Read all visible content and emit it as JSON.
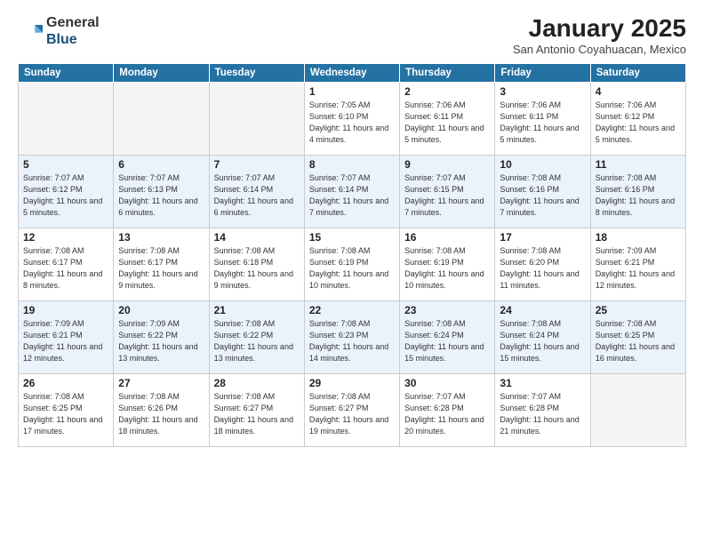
{
  "header": {
    "logo_general": "General",
    "logo_blue": "Blue",
    "month_year": "January 2025",
    "location": "San Antonio Coyahuacan, Mexico"
  },
  "days_of_week": [
    "Sunday",
    "Monday",
    "Tuesday",
    "Wednesday",
    "Thursday",
    "Friday",
    "Saturday"
  ],
  "weeks": [
    [
      {
        "num": "",
        "empty": true
      },
      {
        "num": "",
        "empty": true
      },
      {
        "num": "",
        "empty": true
      },
      {
        "num": "1",
        "sunrise": "7:05 AM",
        "sunset": "6:10 PM",
        "daylight": "11 hours and 4 minutes."
      },
      {
        "num": "2",
        "sunrise": "7:06 AM",
        "sunset": "6:11 PM",
        "daylight": "11 hours and 5 minutes."
      },
      {
        "num": "3",
        "sunrise": "7:06 AM",
        "sunset": "6:11 PM",
        "daylight": "11 hours and 5 minutes."
      },
      {
        "num": "4",
        "sunrise": "7:06 AM",
        "sunset": "6:12 PM",
        "daylight": "11 hours and 5 minutes."
      }
    ],
    [
      {
        "num": "5",
        "sunrise": "7:07 AM",
        "sunset": "6:12 PM",
        "daylight": "11 hours and 5 minutes."
      },
      {
        "num": "6",
        "sunrise": "7:07 AM",
        "sunset": "6:13 PM",
        "daylight": "11 hours and 6 minutes."
      },
      {
        "num": "7",
        "sunrise": "7:07 AM",
        "sunset": "6:14 PM",
        "daylight": "11 hours and 6 minutes."
      },
      {
        "num": "8",
        "sunrise": "7:07 AM",
        "sunset": "6:14 PM",
        "daylight": "11 hours and 7 minutes."
      },
      {
        "num": "9",
        "sunrise": "7:07 AM",
        "sunset": "6:15 PM",
        "daylight": "11 hours and 7 minutes."
      },
      {
        "num": "10",
        "sunrise": "7:08 AM",
        "sunset": "6:16 PM",
        "daylight": "11 hours and 7 minutes."
      },
      {
        "num": "11",
        "sunrise": "7:08 AM",
        "sunset": "6:16 PM",
        "daylight": "11 hours and 8 minutes."
      }
    ],
    [
      {
        "num": "12",
        "sunrise": "7:08 AM",
        "sunset": "6:17 PM",
        "daylight": "11 hours and 8 minutes."
      },
      {
        "num": "13",
        "sunrise": "7:08 AM",
        "sunset": "6:17 PM",
        "daylight": "11 hours and 9 minutes."
      },
      {
        "num": "14",
        "sunrise": "7:08 AM",
        "sunset": "6:18 PM",
        "daylight": "11 hours and 9 minutes."
      },
      {
        "num": "15",
        "sunrise": "7:08 AM",
        "sunset": "6:19 PM",
        "daylight": "11 hours and 10 minutes."
      },
      {
        "num": "16",
        "sunrise": "7:08 AM",
        "sunset": "6:19 PM",
        "daylight": "11 hours and 10 minutes."
      },
      {
        "num": "17",
        "sunrise": "7:08 AM",
        "sunset": "6:20 PM",
        "daylight": "11 hours and 11 minutes."
      },
      {
        "num": "18",
        "sunrise": "7:09 AM",
        "sunset": "6:21 PM",
        "daylight": "11 hours and 12 minutes."
      }
    ],
    [
      {
        "num": "19",
        "sunrise": "7:09 AM",
        "sunset": "6:21 PM",
        "daylight": "11 hours and 12 minutes."
      },
      {
        "num": "20",
        "sunrise": "7:09 AM",
        "sunset": "6:22 PM",
        "daylight": "11 hours and 13 minutes."
      },
      {
        "num": "21",
        "sunrise": "7:08 AM",
        "sunset": "6:22 PM",
        "daylight": "11 hours and 13 minutes."
      },
      {
        "num": "22",
        "sunrise": "7:08 AM",
        "sunset": "6:23 PM",
        "daylight": "11 hours and 14 minutes."
      },
      {
        "num": "23",
        "sunrise": "7:08 AM",
        "sunset": "6:24 PM",
        "daylight": "11 hours and 15 minutes."
      },
      {
        "num": "24",
        "sunrise": "7:08 AM",
        "sunset": "6:24 PM",
        "daylight": "11 hours and 15 minutes."
      },
      {
        "num": "25",
        "sunrise": "7:08 AM",
        "sunset": "6:25 PM",
        "daylight": "11 hours and 16 minutes."
      }
    ],
    [
      {
        "num": "26",
        "sunrise": "7:08 AM",
        "sunset": "6:25 PM",
        "daylight": "11 hours and 17 minutes."
      },
      {
        "num": "27",
        "sunrise": "7:08 AM",
        "sunset": "6:26 PM",
        "daylight": "11 hours and 18 minutes."
      },
      {
        "num": "28",
        "sunrise": "7:08 AM",
        "sunset": "6:27 PM",
        "daylight": "11 hours and 18 minutes."
      },
      {
        "num": "29",
        "sunrise": "7:08 AM",
        "sunset": "6:27 PM",
        "daylight": "11 hours and 19 minutes."
      },
      {
        "num": "30",
        "sunrise": "7:07 AM",
        "sunset": "6:28 PM",
        "daylight": "11 hours and 20 minutes."
      },
      {
        "num": "31",
        "sunrise": "7:07 AM",
        "sunset": "6:28 PM",
        "daylight": "11 hours and 21 minutes."
      },
      {
        "num": "",
        "empty": true
      }
    ]
  ]
}
